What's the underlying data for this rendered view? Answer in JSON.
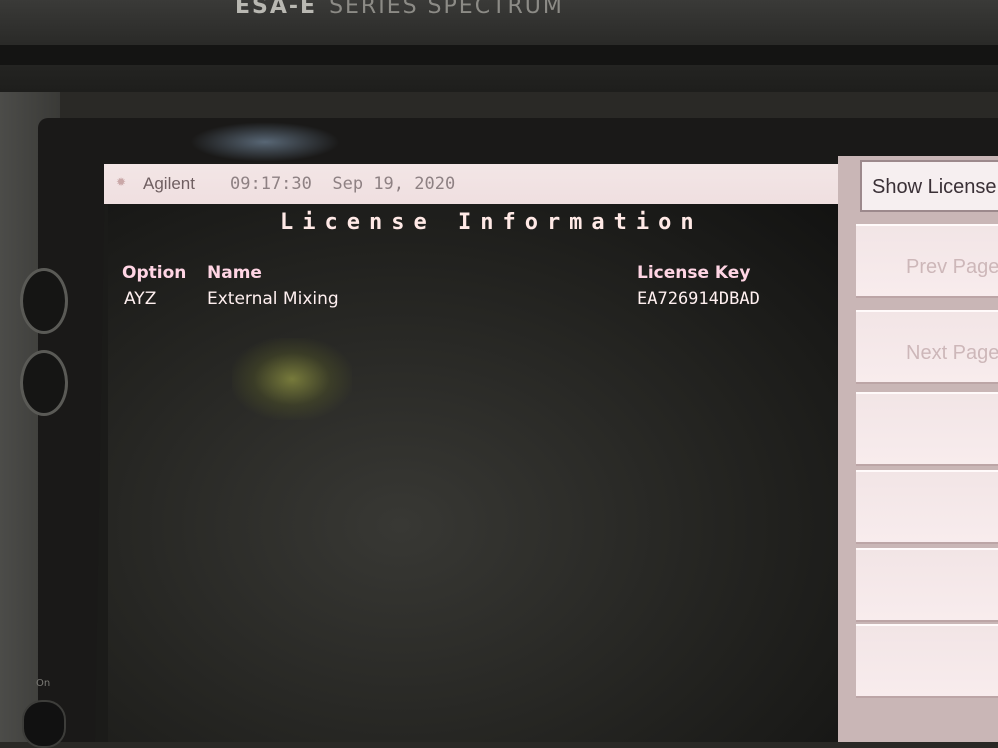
{
  "instrument": {
    "model": "ESA-E",
    "series_text": "SERIES SPECTRUM",
    "power_label": "On"
  },
  "status_bar": {
    "brand": "Agilent",
    "time": "09:17:30",
    "date": "Sep 19, 2020"
  },
  "screen": {
    "title": "License Information",
    "columns": {
      "option": "Option",
      "name": "Name",
      "license_key": "License Key"
    },
    "rows": [
      {
        "option": "AYZ",
        "name": "External Mixing",
        "license_key": "EA726914DBAD"
      }
    ]
  },
  "softkeys": [
    {
      "label": "Show License",
      "active": true
    },
    {
      "label": "Prev Page",
      "active": false
    },
    {
      "label": "Next Page",
      "active": false
    },
    {
      "label": "",
      "active": false
    },
    {
      "label": "",
      "active": false
    },
    {
      "label": "",
      "active": false
    },
    {
      "label": "",
      "active": false
    }
  ],
  "colors": {
    "status_bar_bg": "#f3e6e6",
    "screen_bg": "#232320",
    "screen_text": "#fff0f0",
    "header_text": "#ffd5e4",
    "softkey_bg": "#f2e5e6"
  }
}
